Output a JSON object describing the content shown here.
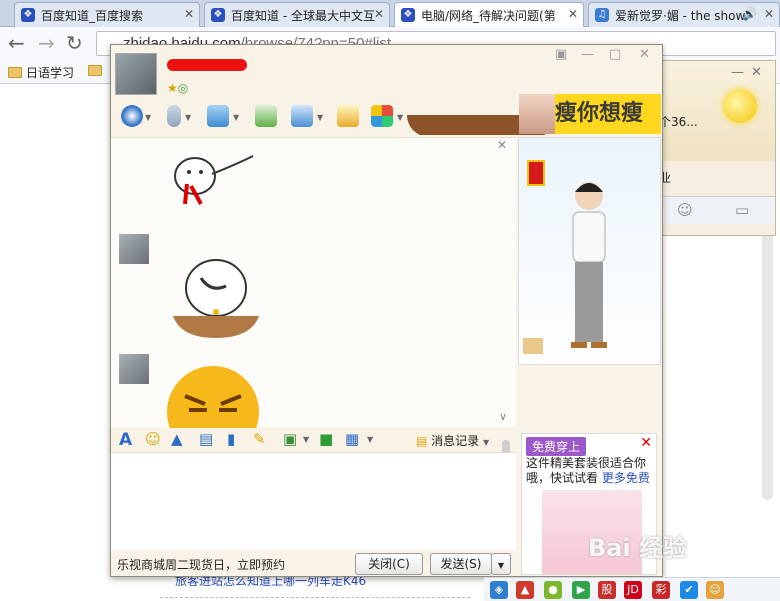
{
  "browser": {
    "tabs": [
      {
        "title": "百度知道_百度搜索",
        "active": false
      },
      {
        "title": "百度知道 - 全球最大中文互",
        "active": false
      },
      {
        "title": "电脑/网络_待解决问题(第",
        "active": true
      },
      {
        "title": "爱新觉罗·媚 - the show",
        "active": false
      }
    ],
    "url_host": "zhidao.baidu.com",
    "url_path": "/browse/74?pn=50#list",
    "bookmarks": [
      "日语学习"
    ],
    "page_snippet": "旅客进站怎么知道上哪一列车走K46"
  },
  "qq_main": {
    "snippet1": "个36...",
    "snippet2": "业"
  },
  "chat": {
    "ad_banner": "瘦你想瘦",
    "format_toolbar": {
      "font_icon": "A",
      "history_label": "消息记录"
    },
    "promo_text": "乐视商城周二现货日，立即预约",
    "close_button": "关闭(C)",
    "send_button": "发送(S)"
  },
  "side_ad": {
    "badge": "免费穿上",
    "text": "这件精美套装很适合你哦，快试试看",
    "link": "更多免费",
    "close": "✕",
    "watermark": "Bai 经验"
  },
  "tray_icons": [
    "股",
    "JD",
    "彩"
  ],
  "colors": {
    "accent": "#2a4fbf",
    "ad_yellow": "#ffd71e",
    "tray": "#f1f4f8"
  }
}
